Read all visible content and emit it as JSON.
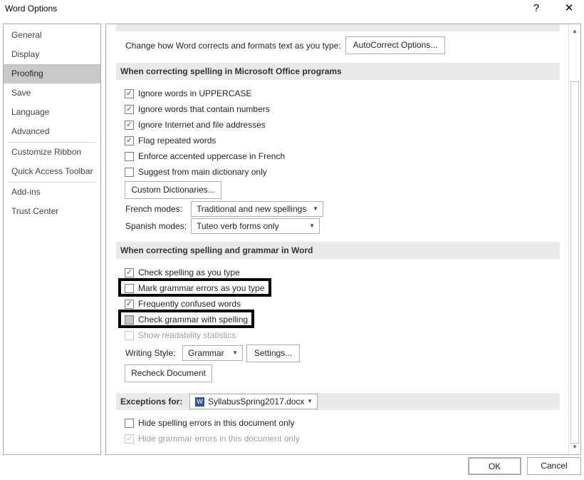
{
  "window": {
    "title": "Word Options",
    "help": "?",
    "close": "✕"
  },
  "sidebar": {
    "items": [
      {
        "label": "General"
      },
      {
        "label": "Display"
      },
      {
        "label": "Proofing",
        "selected": true
      },
      {
        "label": "Save"
      },
      {
        "label": "Language"
      },
      {
        "label": "Advanced"
      },
      {
        "label": "Customize Ribbon"
      },
      {
        "label": "Quick Access Toolbar"
      },
      {
        "label": "Add-ins"
      },
      {
        "label": "Trust Center"
      }
    ]
  },
  "autocorrect": {
    "text": "Change how Word corrects and formats text as you type:",
    "button": "AutoCorrect Options..."
  },
  "office_section": {
    "header": "When correcting spelling in Microsoft Office programs",
    "options": [
      {
        "label": "Ignore words in UPPERCASE",
        "checked": true
      },
      {
        "label": "Ignore words that contain numbers",
        "checked": true
      },
      {
        "label": "Ignore Internet and file addresses",
        "checked": true
      },
      {
        "label": "Flag repeated words",
        "checked": true
      },
      {
        "label": "Enforce accented uppercase in French",
        "checked": false
      },
      {
        "label": "Suggest from main dictionary only",
        "checked": false
      }
    ],
    "custom_dictionaries": "Custom Dictionaries...",
    "french_label": "French modes:",
    "french_value": "Traditional and new spellings",
    "spanish_label": "Spanish modes:",
    "spanish_value": "Tuteo verb forms only"
  },
  "word_section": {
    "header": "When correcting spelling and grammar in Word",
    "options": [
      {
        "label": "Check spelling as you type",
        "checked": true
      },
      {
        "label": "Mark grammar errors as you type",
        "checked": false,
        "highlighted": true
      },
      {
        "label": "Frequently confused words",
        "checked": true
      },
      {
        "label": "Check grammar with spelling",
        "checked": "indeterminate",
        "highlighted": true
      },
      {
        "label": "Show readability statistics",
        "checked": false,
        "disabled": true
      }
    ],
    "writing_style_label": "Writing Style:",
    "writing_style_value": "Grammar",
    "settings": "Settings...",
    "recheck": "Recheck Document"
  },
  "exceptions": {
    "label": "Exceptions for:",
    "document": "SyllabusSpring2017.docx",
    "doc_icon": "word-document-icon",
    "options": [
      {
        "label": "Hide spelling errors in this document only",
        "checked": false
      },
      {
        "label": "Hide grammar errors in this document only",
        "checked": true,
        "disabled": true
      }
    ]
  },
  "footer": {
    "ok": "OK",
    "cancel": "Cancel"
  }
}
